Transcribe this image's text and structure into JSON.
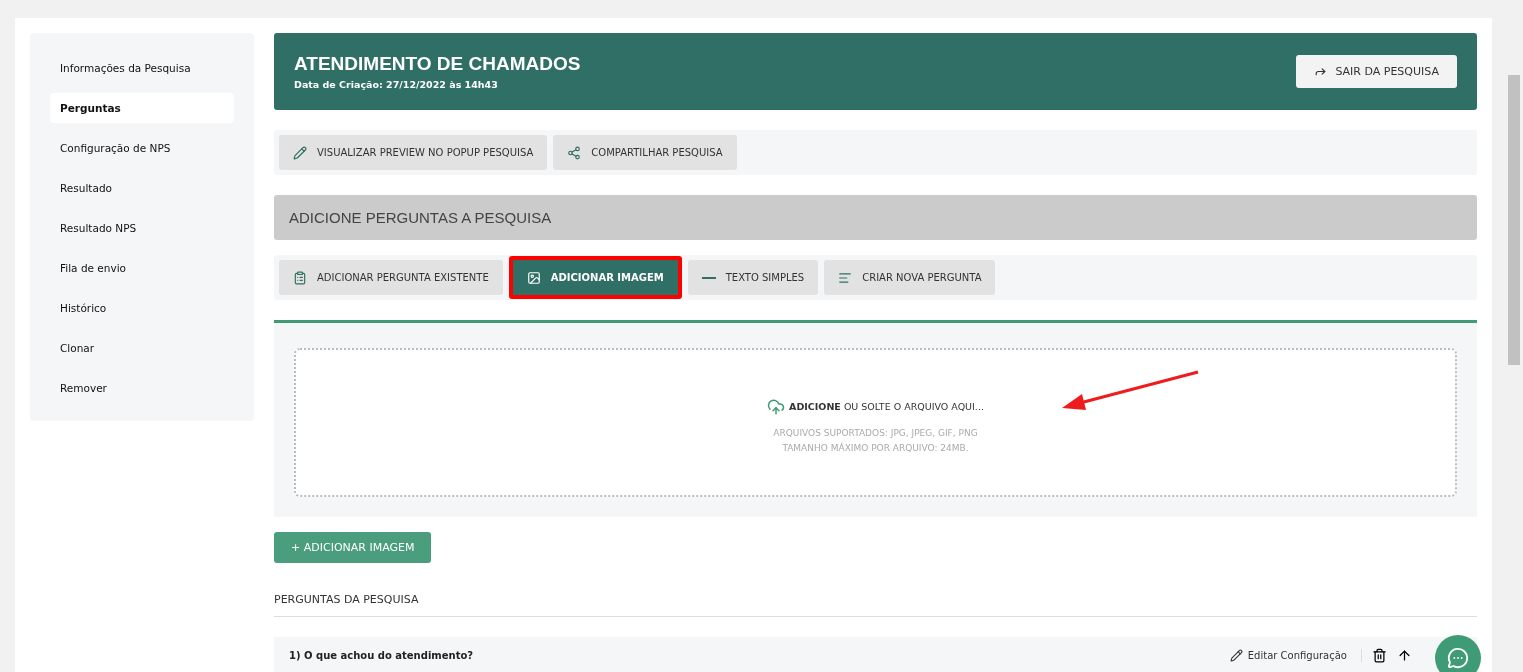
{
  "sidebar": {
    "items": [
      {
        "label": "Informações da Pesquisa",
        "selected": false
      },
      {
        "label": "Perguntas",
        "selected": true
      },
      {
        "label": "Configuração de NPS",
        "selected": false
      },
      {
        "label": "Resultado",
        "selected": false
      },
      {
        "label": "Resultado NPS",
        "selected": false
      },
      {
        "label": "Fila de envio",
        "selected": false
      },
      {
        "label": "Histórico",
        "selected": false
      },
      {
        "label": "Clonar",
        "selected": false
      },
      {
        "label": "Remover",
        "selected": false
      }
    ]
  },
  "header": {
    "title": "ATENDIMENTO DE CHAMADOS",
    "subtitle": "Data de Criação: 27/12/2022 às 14h43",
    "exit_button": "SAIR DA PESQUISA"
  },
  "toolbar": [
    {
      "kind": "preview",
      "label": "VISUALIZAR PREVIEW NO POPUP PESQUISA"
    },
    {
      "kind": "share",
      "label": "COMPARTILHAR PESQUISA"
    }
  ],
  "section_title": "ADICIONE PERGUNTAS A PESQUISA",
  "add_options": [
    {
      "kind": "existing",
      "label": "ADICIONAR PERGUNTA EXISTENTE",
      "selected": false
    },
    {
      "kind": "image",
      "label": "ADICIONAR IMAGEM",
      "selected": true
    },
    {
      "kind": "text",
      "label": "TEXTO SIMPLES",
      "selected": false
    },
    {
      "kind": "new",
      "label": "CRIAR NOVA PERGUNTA",
      "selected": false
    }
  ],
  "dropzone": {
    "prompt": "**ADICIONE** OU SOLTE O ARQUIVO AQUI...",
    "hint_lines": [
      "ARQUIVOS SUPORTADOS: JPG, JPEG, GIF, PNG",
      "TAMANHO MÁXIMO POR ARQUIVO: 24MB."
    ]
  },
  "add_image_button": "+ ADICIONAR IMAGEM",
  "questions_title": "PERGUNTAS DA PESQUISA",
  "questions": [
    {
      "title": "1) O que achou do atendimento?",
      "edit_label": "Editar Configuração"
    }
  ]
}
